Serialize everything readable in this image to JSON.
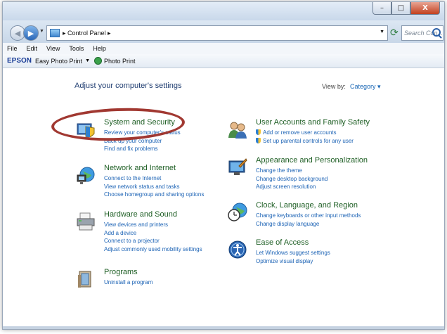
{
  "titlebar": {
    "buttons": {
      "minimize": "–",
      "maximize": "□",
      "close": "X"
    }
  },
  "address": {
    "back_glyph": "◀",
    "forward_glyph": "▶",
    "path": "▸ Control Panel ▸",
    "search_placeholder": "Search Con...",
    "icons": {
      "back": "back-arrow-icon",
      "forward": "forward-arrow-icon",
      "refresh": "refresh-icon",
      "search": "search-icon",
      "path": "control-panel-icon"
    }
  },
  "menu": [
    "File",
    "Edit",
    "View",
    "Tools",
    "Help"
  ],
  "epson": {
    "logo": "EPSON",
    "item1": "Easy Photo Print",
    "item2": "Photo Print"
  },
  "main": {
    "heading": "Adjust your computer's settings",
    "view_by_label": "View by:",
    "view_by_value": "Category ▾"
  },
  "categories": [
    {
      "title": "System and Security",
      "icon": "shield-pc-icon",
      "links": [
        "Review your computer's status",
        "Back up your computer",
        "Find and fix problems"
      ]
    },
    {
      "title": "Network and Internet",
      "icon": "globe-network-icon",
      "links": [
        "Connect to the Internet",
        "View network status and tasks",
        "Choose homegroup and sharing options"
      ]
    },
    {
      "title": "Hardware and Sound",
      "icon": "printer-icon",
      "links": [
        "View devices and printers",
        "Add a device",
        "Connect to a projector",
        "Adjust commonly used mobility settings"
      ]
    },
    {
      "title": "Programs",
      "icon": "programs-icon",
      "links": [
        "Uninstall a program"
      ]
    },
    {
      "title": "User Accounts and Family Safety",
      "icon": "users-icon",
      "links": [
        "Add or remove user accounts",
        "Set up parental controls for any user"
      ]
    },
    {
      "title": "Appearance and Personalization",
      "icon": "appearance-icon",
      "links": [
        "Change the theme",
        "Change desktop background",
        "Adjust screen resolution"
      ]
    },
    {
      "title": "Clock, Language, and Region",
      "icon": "clock-globe-icon",
      "links": [
        "Change keyboards or other input methods",
        "Change display language"
      ]
    },
    {
      "title": "Ease of Access",
      "icon": "ease-of-access-icon",
      "links": [
        "Let Windows suggest settings",
        "Optimize visual display"
      ]
    }
  ],
  "colors": {
    "category_title": "#1f5f25",
    "link": "#1c63b5",
    "highlight_ellipse": "#a13831"
  }
}
